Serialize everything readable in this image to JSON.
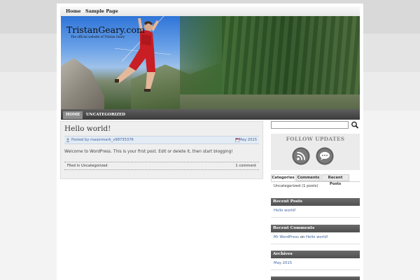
{
  "top_nav": {
    "items": [
      "Home",
      "Sample Page"
    ]
  },
  "header": {
    "site_title": "TristanGeary.com",
    "site_description": "The official website of Tristan Geary"
  },
  "category_nav": {
    "home": "HOME",
    "uncategorized": "UNCATEGORIZED"
  },
  "post": {
    "title": "Hello world!",
    "author_line": "Posted by maxormark_v98735376",
    "date": "7 May 2015",
    "body": "Welcome to WordPress. This is your first post. Edit or delete it, then start blogging!",
    "filed_in": "Filed in Uncategorized",
    "comments": "1 comment"
  },
  "sidebar": {
    "search": {
      "value": "",
      "placeholder": ""
    },
    "follow_updates_title": "FOLLOW UPDATES",
    "tabs": [
      "Categories",
      "Comments",
      "Recent Posts"
    ],
    "tab_content": "Uncategorized  (1 posts)",
    "recent_posts": {
      "title": "Recent Posts",
      "items": [
        "Hello world!"
      ]
    },
    "recent_comments": {
      "title": "Recent Comments",
      "author": "Mr WordPress",
      "on": "on",
      "post": "Hello world!"
    },
    "archives": {
      "title": "Archives",
      "items": [
        "May 2015"
      ]
    }
  },
  "icons": [
    "search-icon",
    "rss-icon",
    "chat-bubble-icon",
    "author-icon",
    "calendar-icon"
  ],
  "colors": {
    "link": "#3f64a0",
    "nav_dark": "#3b3b3b",
    "widget_header": "#555555",
    "post_bg": "#efefef"
  }
}
